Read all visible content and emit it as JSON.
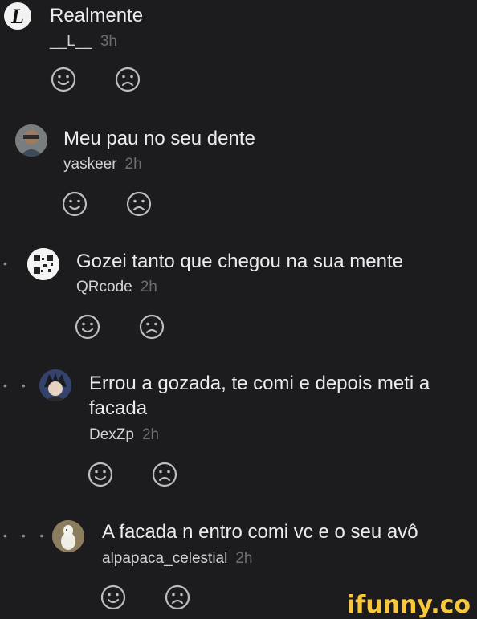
{
  "comments": [
    {
      "text": "Realmente",
      "username": "__L__",
      "time": "3h",
      "avatar_icon": "death-note-L-letter-icon",
      "depth_dots": ""
    },
    {
      "text": "Meu pau no seu dente",
      "username": "yaskeer",
      "time": "2h",
      "avatar_icon": "user-photo-avatar",
      "depth_dots": ""
    },
    {
      "text": "Gozei tanto que chegou na sua mente",
      "username": "QRcode",
      "time": "2h",
      "avatar_icon": "qr-code-avatar",
      "depth_dots": "•"
    },
    {
      "text": "Errou a gozada, te comi e depois meti a facada",
      "username": "DexZp",
      "time": "2h",
      "avatar_icon": "anime-character-avatar",
      "depth_dots": "• •"
    },
    {
      "text": "A facada n entro comi vc e o seu avô",
      "username": "alpapaca_celestial",
      "time": "2h",
      "avatar_icon": "alpaca-photo-avatar",
      "depth_dots": "• • •"
    }
  ],
  "reactions": {
    "smile_icon": "smile-icon",
    "frown_icon": "frown-icon"
  },
  "watermark": {
    "text": "ifunny.co"
  },
  "colors": {
    "background": "#1c1c1f",
    "watermark": "#f9c83a",
    "text": "#ececec",
    "meta": "#6e6e72"
  }
}
